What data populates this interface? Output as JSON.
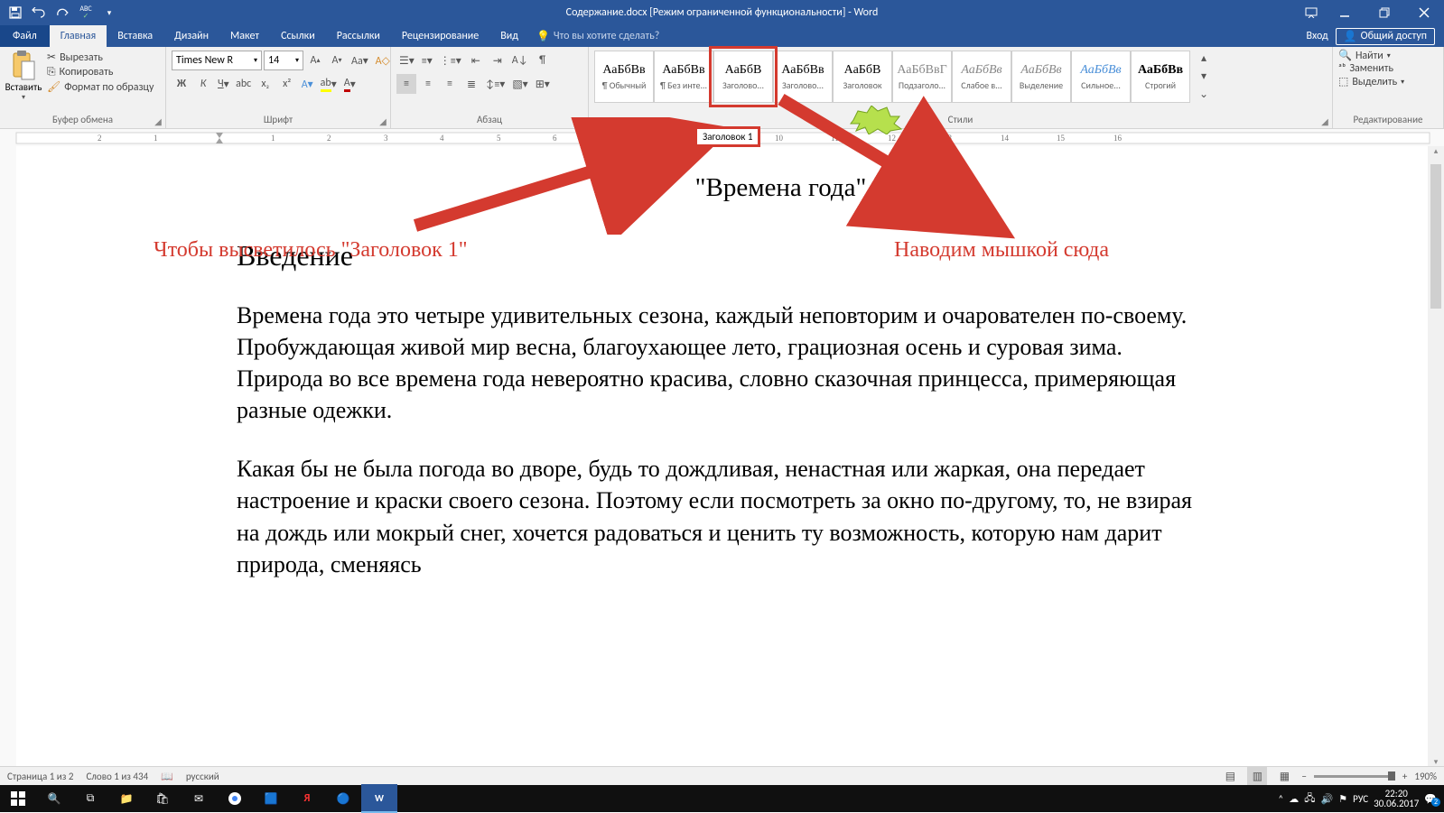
{
  "title": "Содержание.docx [Режим ограниченной функциональности] - Word",
  "qat": {
    "save": "💾",
    "undo": "↶",
    "redo": "↷",
    "spell": "ABC"
  },
  "tabs": {
    "file": "Файл",
    "items": [
      "Главная",
      "Вставка",
      "Дизайн",
      "Макет",
      "Ссылки",
      "Рассылки",
      "Рецензирование",
      "Вид"
    ],
    "tell_me": "Что вы хотите сделать?",
    "signin": "Вход",
    "share": "Общий доступ"
  },
  "ribbon": {
    "clipboard": {
      "label": "Буфер обмена",
      "paste": "Вставить",
      "cut": "Вырезать",
      "copy": "Копировать",
      "format": "Формат по образцу"
    },
    "font": {
      "label": "Шрифт",
      "name": "Times New R",
      "size": "14",
      "bold": "Ж",
      "italic": "К",
      "underline": "Ч"
    },
    "paragraph": {
      "label": "Абзац"
    },
    "styles": {
      "label": "Стили",
      "items": [
        {
          "sample": "АаБбВв",
          "label": "¶ Обычный",
          "color": "#000"
        },
        {
          "sample": "АаБбВв",
          "label": "¶ Без инте...",
          "color": "#000"
        },
        {
          "sample": "АаБбВ",
          "label": "Заголово...",
          "color": "#000",
          "highlight": true
        },
        {
          "sample": "АаБбВв",
          "label": "Заголово...",
          "color": "#000"
        },
        {
          "sample": "АаБбВ",
          "label": "Заголовок",
          "color": "#000"
        },
        {
          "sample": "АаБбВвГ",
          "label": "Подзаголо...",
          "color": "#888"
        },
        {
          "sample": "АаБбВв",
          "label": "Слабое в...",
          "color": "#888",
          "italic": true
        },
        {
          "sample": "АаБбВв",
          "label": "Выделение",
          "color": "#888",
          "italic": true
        },
        {
          "sample": "АаБбВв",
          "label": "Сильное...",
          "color": "#4A8FD8",
          "italic": true
        },
        {
          "sample": "АаБбВв",
          "label": "Строгий",
          "color": "#000",
          "bold": true
        }
      ]
    },
    "editing": {
      "label": "Редактирование",
      "find": "Найти",
      "replace": "Заменить",
      "select": "Выделить"
    }
  },
  "tooltip": "Заголовок 1",
  "doc": {
    "title": "\"Времена года\"",
    "heading": "Введение",
    "p1": "Времена года это четыре удивительных сезона, каждый неповторим и очарователен по-своему. Пробуждающая живой мир весна, благоухающее лето, грациозная осень и суровая зима. Природа во все времена года невероятно красива, словно сказочная принцесса, примеряющая разные одежки.",
    "p2": "Какая бы не была погода во дворе, будь то дождливая, ненастная или жаркая, она передает настроение и краски своего сезона. Поэтому если посмотреть за окно по-другому, то, не взирая на дождь или мокрый снег, хочется радоваться и ценить ту возможность, которую нам дарит природа, сменяясь"
  },
  "annotations": {
    "left": "Чтобы высветилось \"Заголовок 1\"",
    "right": "Наводим мышкой сюда"
  },
  "status": {
    "page": "Страница 1 из 2",
    "words": "Слово 1 из 434",
    "lang": "русский",
    "zoom": "190%"
  },
  "taskbar": {
    "lang": "РУС",
    "time": "22:20",
    "date": "30.06.2017",
    "notif": "2"
  }
}
